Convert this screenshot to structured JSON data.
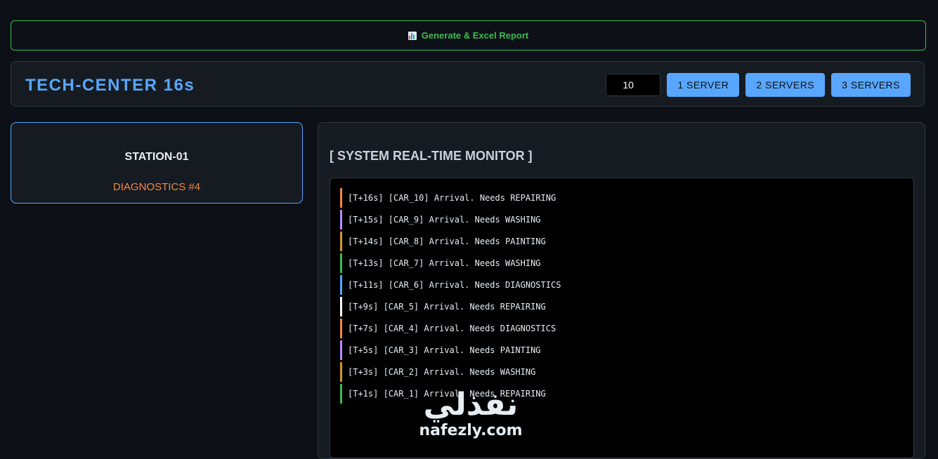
{
  "report_button": {
    "icon": "bar-chart-icon",
    "label": "Generate & Excel Report"
  },
  "header": {
    "title": "TECH-CENTER 16s",
    "car_count_value": "10",
    "server_buttons": [
      "1 SERVER",
      "2 SERVERS",
      "3 SERVERS"
    ]
  },
  "station": {
    "name": "STATION-01",
    "status": "DIAGNOSTICS #4"
  },
  "monitor": {
    "title": "[ SYSTEM REAL-TIME MONITOR ]",
    "log": [
      {
        "text": "[T+16s] [CAR_10] Arrival. Needs REPAIRING",
        "color": "#f0883e"
      },
      {
        "text": "[T+15s] [CAR_9] Arrival. Needs WASHING",
        "color": "#bc8cff"
      },
      {
        "text": "[T+14s] [CAR_8] Arrival. Needs PAINTING",
        "color": "#d29922"
      },
      {
        "text": "[T+13s] [CAR_7] Arrival. Needs WASHING",
        "color": "#3fb950"
      },
      {
        "text": "[T+11s] [CAR_6] Arrival. Needs DIAGNOSTICS",
        "color": "#58a6ff"
      },
      {
        "text": "[T+9s] [CAR_5] Arrival. Needs REPAIRING",
        "color": "#ffffff"
      },
      {
        "text": "[T+7s] [CAR_4] Arrival. Needs DIAGNOSTICS",
        "color": "#f0883e"
      },
      {
        "text": "[T+5s] [CAR_3] Arrival. Needs PAINTING",
        "color": "#bc8cff"
      },
      {
        "text": "[T+3s] [CAR_2] Arrival. Needs WASHING",
        "color": "#d29922"
      },
      {
        "text": "[T+1s] [CAR_1] Arrival. Needs REPAIRING",
        "color": "#3fb950"
      }
    ]
  },
  "watermark": {
    "arabic": "نفذلي",
    "latin": "nafezly.com"
  },
  "colors": {
    "accent": "#58a6ff",
    "success": "#3fb950",
    "warning": "#f0883e",
    "background": "#0d1117"
  }
}
